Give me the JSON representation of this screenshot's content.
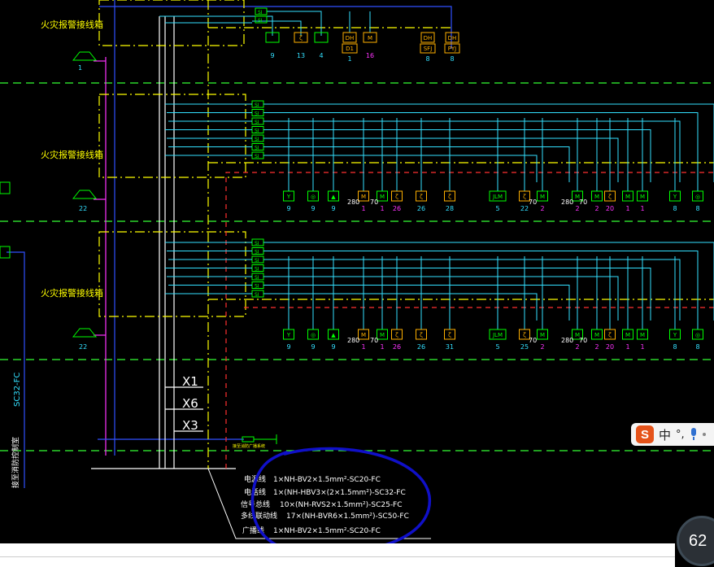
{
  "panels": {
    "title_1": "火灾报警接线箱",
    "title_2": "火灾报警接线箱",
    "title_3": "火灾报警接线箱",
    "si_label": "SI"
  },
  "top_row": {
    "devices": [
      {
        "glyph": "",
        "count": "9",
        "color": "#00ff00"
      },
      {
        "glyph": "ζ",
        "count": "13",
        "color": "#ffb000"
      },
      {
        "glyph": "",
        "count": "4",
        "color": "#00ff00"
      },
      {
        "glyph": "DH",
        "sub": "D1",
        "count": "1",
        "color": "#ffb000"
      },
      {
        "glyph": "M",
        "count": "16",
        "color": "#ffb000"
      },
      {
        "glyph": "DH",
        "sub": "SFJ",
        "count": "8",
        "color": "#ffb000"
      },
      {
        "glyph": "DH",
        "sub": "PYJ",
        "count": "8",
        "color": "#ffb000"
      }
    ]
  },
  "floor_rows": [
    {
      "counts": [
        "9",
        "9",
        "9",
        "1",
        "1",
        "26",
        "26",
        "28",
        "5",
        "22",
        "2",
        "2",
        "2",
        "20",
        "1",
        "1",
        "8",
        "8"
      ],
      "left_count": "22",
      "speaker_count": "1",
      "labels_280": [
        "280",
        "70",
        "70",
        "280",
        "70"
      ]
    },
    {
      "counts": [
        "9",
        "9",
        "9",
        "1",
        "1",
        "26",
        "26",
        "31",
        "5",
        "25",
        "2",
        "2",
        "2",
        "20",
        "1",
        "1",
        "8",
        "8"
      ],
      "left_count": "22",
      "labels_280": [
        "280",
        "70",
        "70",
        "280",
        "70"
      ]
    }
  ],
  "bus_labels": [
    "X1",
    "X6",
    "X3"
  ],
  "riser": {
    "vertical_label": "SC32-FC",
    "bottom_label": "接至消防控制室",
    "jlm": "JLM"
  },
  "legend": {
    "small_label": "接至消防广播系统",
    "rows": [
      {
        "name": "电源线",
        "spec": "1×NH-BV2×1.5mm²-SC20-FC"
      },
      {
        "name": "电话线",
        "spec": "1×(NH-HBV3×(2×1.5mm²)-SC32-FC"
      },
      {
        "name": "信号总线",
        "spec": "10×(NH-RVS2×1.5mm²)-SC25-FC"
      },
      {
        "name": "多线联动线",
        "spec": "17×(NH-BVR6×1.5mm²)-SC50-FC"
      },
      {
        "name": "广播线",
        "spec": "1×NH-BV2×1.5mm²-SC20-FC"
      }
    ]
  },
  "ime": {
    "logo": "S",
    "mode": "中",
    "punct": "°,"
  },
  "zoom": {
    "value": "62"
  },
  "colors": {
    "cyan": "#33e0ff",
    "green_dash": "#33ff33",
    "yellow": "#ffff00",
    "red_dash": "#ff3030",
    "magenta": "#ff33ff",
    "blue": "#3050ff",
    "device_green": "#00ff00",
    "device_orange": "#ffb000",
    "white": "#ffffff",
    "circle": "#1010c8"
  }
}
